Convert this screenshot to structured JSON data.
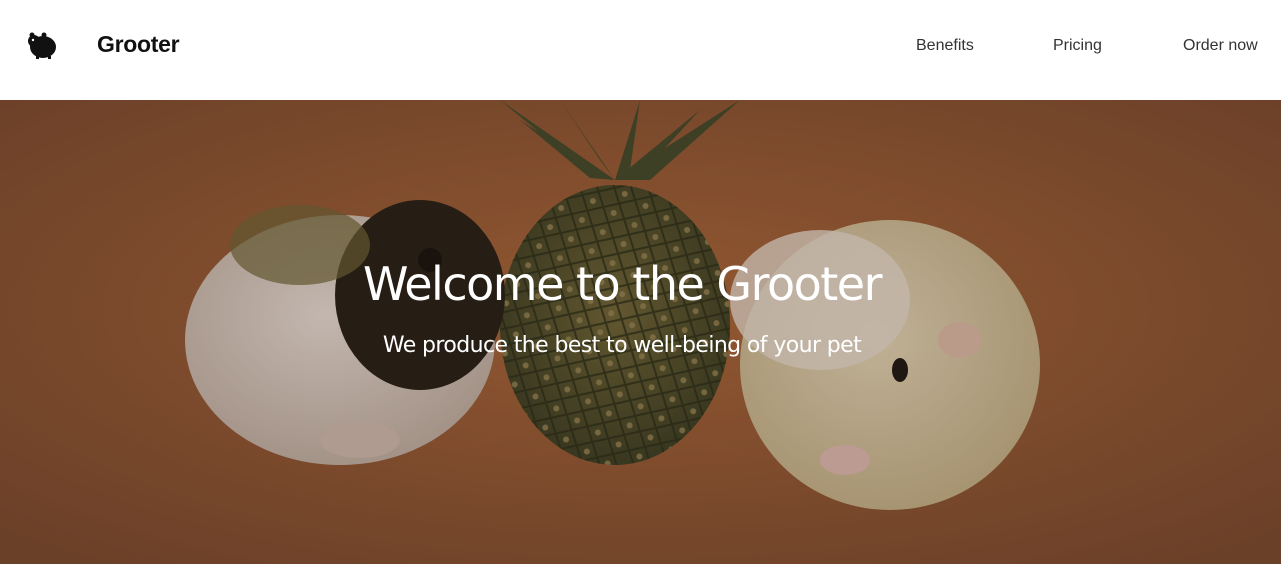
{
  "header": {
    "logo_icon": "guinea-pig-icon",
    "brand": "Grooter",
    "nav": [
      {
        "label": "Benefits"
      },
      {
        "label": "Pricing"
      },
      {
        "label": "Order now"
      }
    ]
  },
  "hero": {
    "title": "Welcome to the Grooter",
    "subtitle": "We produce the best to well-being of your pet",
    "background_image": "two guinea pigs beside a pineapple on an orange background"
  },
  "colors": {
    "header_bg": "#ffffff",
    "brand_text": "#111111",
    "nav_text": "#333333",
    "hero_bg": "#8a5a3a",
    "hero_text": "#ffffff"
  }
}
